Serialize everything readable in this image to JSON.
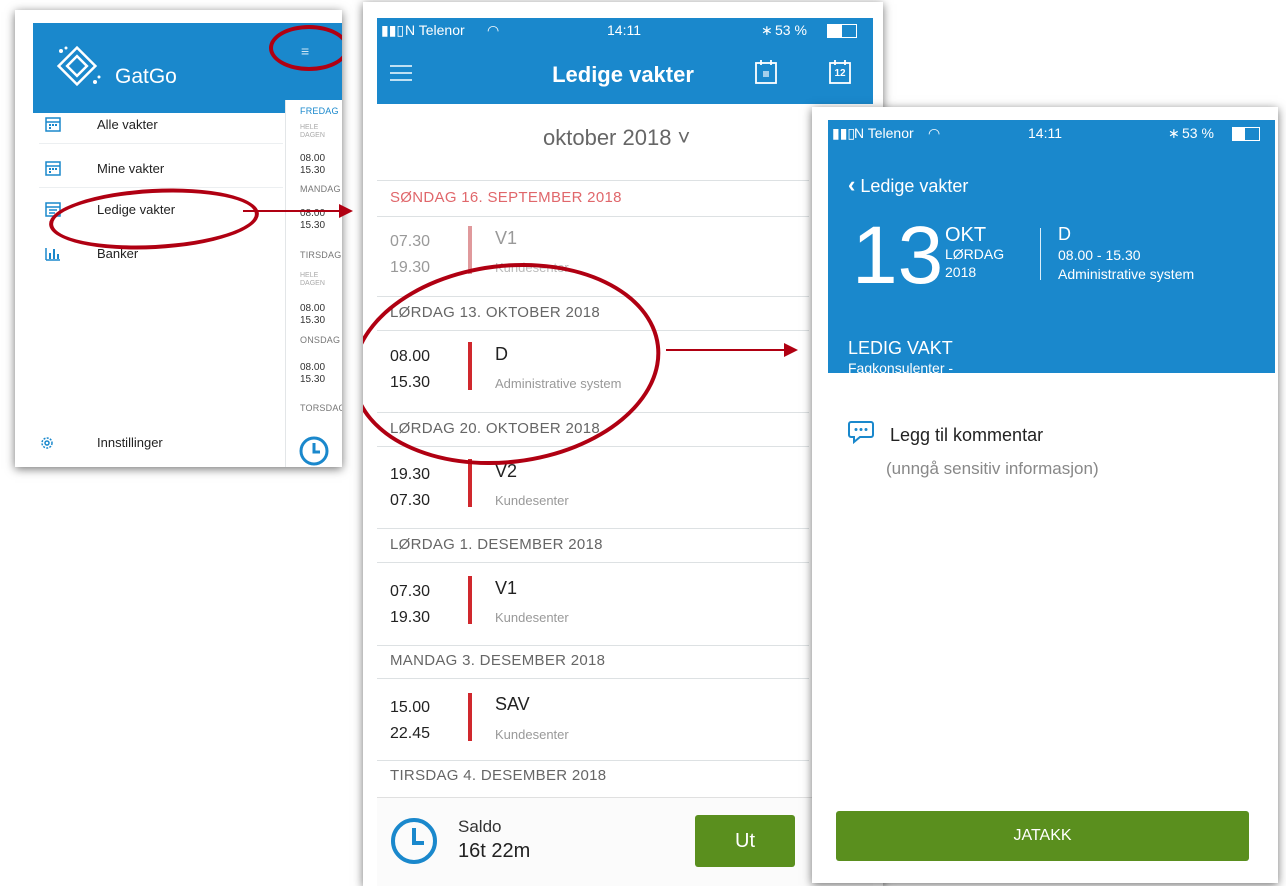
{
  "screen1": {
    "brand": "GatGo",
    "menu_icon": "≡",
    "menu": [
      {
        "label": "Alle vakter",
        "icon": "calendar-icon"
      },
      {
        "label": "Mine vakter",
        "icon": "calendar-icon"
      },
      {
        "label": "Ledige vakter",
        "icon": "calendar-list-icon"
      },
      {
        "label": "Banker",
        "icon": "bar-chart-icon"
      }
    ],
    "settings_label": "Innstillinger",
    "side_days": [
      {
        "label": "FREDAG",
        "type": "day"
      },
      {
        "label": "HELE DAGEN",
        "type": "hele"
      },
      {
        "label": "08.00 15.30",
        "type": "time"
      },
      {
        "label": "MANDAG",
        "type": "day"
      },
      {
        "label": "08.00 15.30",
        "type": "time"
      },
      {
        "label": "TIRSDAG",
        "type": "day"
      },
      {
        "label": "HELE DAGEN",
        "type": "hele"
      },
      {
        "label": "08.00 15.30",
        "type": "time"
      },
      {
        "label": "ONSDAG",
        "type": "day"
      },
      {
        "label": "08.00 15.30",
        "type": "time"
      },
      {
        "label": "TORSDAG",
        "type": "day"
      }
    ]
  },
  "screen2": {
    "carrier": "N Telenor",
    "time": "14:11",
    "battery": "53 %",
    "title": "Ledige vakter",
    "calendar_badge": "12",
    "month": "oktober 2018 ˅",
    "groups": [
      {
        "header": "SØNDAG 16. SEPTEMBER 2018",
        "past": true,
        "shift": {
          "start": "07.30",
          "end": "19.30",
          "code": "V1",
          "place": "Kundesenter"
        }
      },
      {
        "header": "LØRDAG 13. OKTOBER 2018",
        "past": false,
        "shift": {
          "start": "08.00",
          "end": "15.30",
          "code": "D",
          "place": "Administrative system"
        }
      },
      {
        "header": "LØRDAG 20. OKTOBER 2018",
        "past": false,
        "shift": {
          "start": "19.30",
          "end": "07.30",
          "code": "V2",
          "place": "Kundesenter"
        }
      },
      {
        "header": "LØRDAG 1. DESEMBER 2018",
        "past": false,
        "shift": {
          "start": "07.30",
          "end": "19.30",
          "code": "V1",
          "place": "Kundesenter"
        }
      },
      {
        "header": "MANDAG 3. DESEMBER 2018",
        "past": false,
        "shift": {
          "start": "15.00",
          "end": "22.45",
          "code": "SAV",
          "place": "Kundesenter"
        }
      },
      {
        "header": "TIRSDAG 4. DESEMBER 2018",
        "past": false,
        "shift": null
      }
    ],
    "saldo_label": "Saldo",
    "saldo_value": "16t 22m",
    "ut_label": "Ut"
  },
  "screen3": {
    "carrier": "N Telenor",
    "time": "14:11",
    "battery": "53 %",
    "back_label": "Ledige vakter",
    "day_number": "13",
    "month_abbr": "OKT",
    "weekday": "LØRDAG",
    "year": "2018",
    "code": "D",
    "hours": "08.00 - 15.30",
    "place": "Administrative system",
    "status": "LEDIG VAKT",
    "department": "Fagkonsulenter -",
    "comment_label": "Legg til kommentar",
    "comment_hint": "(unngå sensitiv informasjon)",
    "accept_label": "JATAKK"
  },
  "colors": {
    "primary": "#1a88cc",
    "accent_red": "#d0282d",
    "annotation_red": "#b00012",
    "green": "#5a8f1e"
  }
}
